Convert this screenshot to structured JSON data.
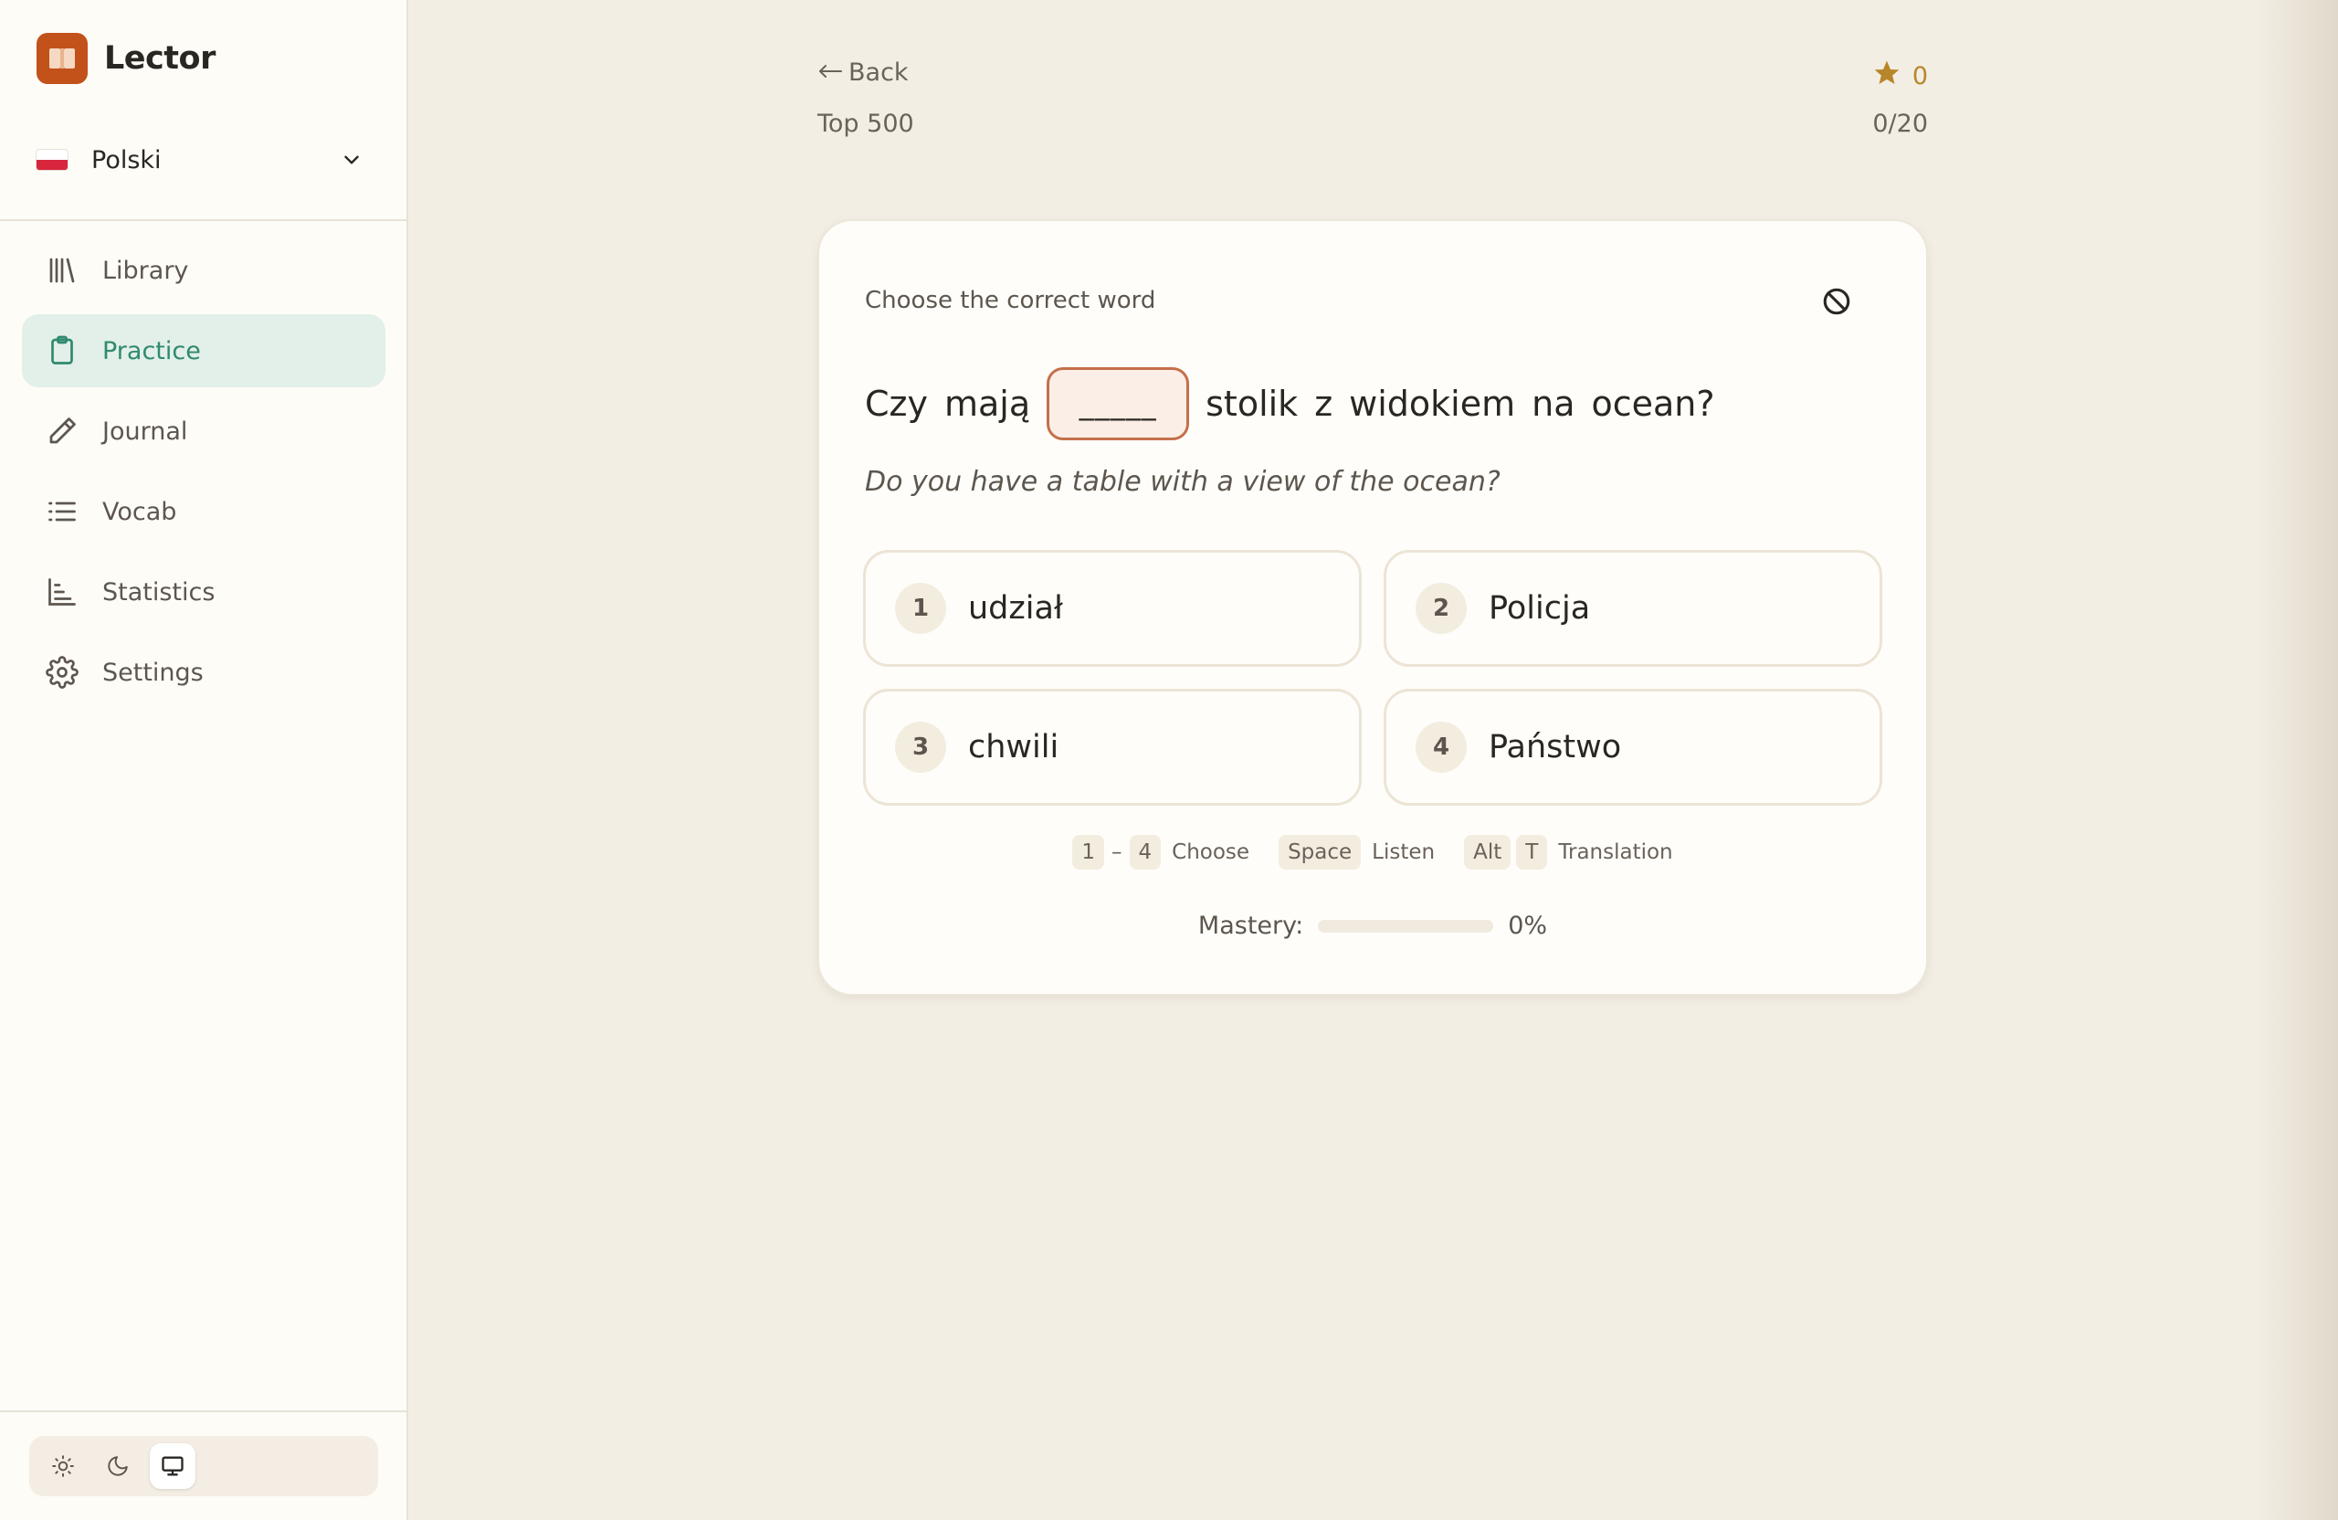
{
  "app": {
    "name": "Lector",
    "language": "Polski"
  },
  "nav": {
    "items": [
      {
        "id": "library",
        "label": "Library",
        "icon": "library-icon",
        "active": false
      },
      {
        "id": "practice",
        "label": "Practice",
        "icon": "clipboard-icon",
        "active": true
      },
      {
        "id": "journal",
        "label": "Journal",
        "icon": "pencil-icon",
        "active": false
      },
      {
        "id": "vocab",
        "label": "Vocab",
        "icon": "list-icon",
        "active": false
      },
      {
        "id": "statistics",
        "label": "Statistics",
        "icon": "bar-chart-icon",
        "active": false
      },
      {
        "id": "settings",
        "label": "Settings",
        "icon": "gear-icon",
        "active": false
      }
    ]
  },
  "theme": {
    "options": [
      "light",
      "dark",
      "system"
    ],
    "selected": "system"
  },
  "header": {
    "back_label": "Back",
    "deck_name": "Top 500",
    "score": "0",
    "progress": "0/20"
  },
  "exercise": {
    "prompt": "Choose the correct word",
    "sentence_before": [
      "Czy",
      "mają"
    ],
    "blank": "_____",
    "sentence_after": [
      "stolik",
      "z",
      "widokiem",
      "na",
      "ocean?"
    ],
    "translation": "Do you have a table with a view of the ocean?",
    "options": [
      {
        "num": "1",
        "label": "udział"
      },
      {
        "num": "2",
        "label": "Policja"
      },
      {
        "num": "3",
        "label": "chwili"
      },
      {
        "num": "4",
        "label": "Państwo"
      }
    ]
  },
  "hints": {
    "range_start": "1",
    "range_sep": "–",
    "range_end": "4",
    "choose_label": "Choose",
    "space_key": "Space",
    "listen_label": "Listen",
    "alt_key": "Alt",
    "t_key": "T",
    "translation_label": "Translation"
  },
  "mastery": {
    "label": "Mastery:",
    "value_text": "0%",
    "fraction": 0
  },
  "colors": {
    "brand": "#c2511a",
    "accent": "#2f8a6e",
    "star": "#b8862a",
    "blank_border": "#c4704a"
  }
}
